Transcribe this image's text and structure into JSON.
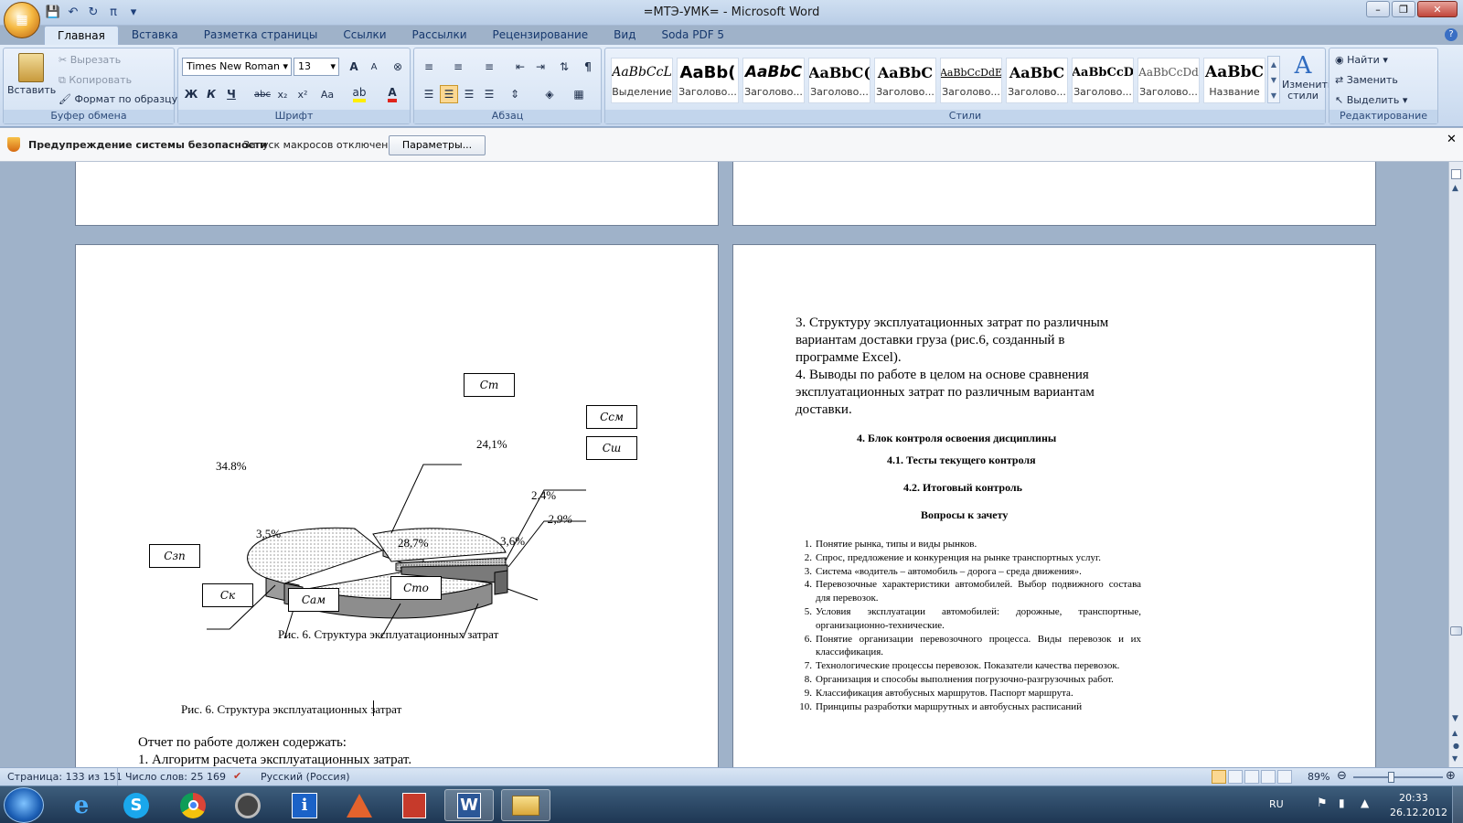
{
  "window": {
    "title": "=МТЭ-УМК= - Microsoft Word"
  },
  "tabs": [
    "Главная",
    "Вставка",
    "Разметка страницы",
    "Ссылки",
    "Рассылки",
    "Рецензирование",
    "Вид",
    "Soda PDF 5"
  ],
  "ribbon": {
    "clipboard": {
      "paste": "Вставить",
      "cut": "Вырезать",
      "copy": "Копировать",
      "format_painter": "Формат по образцу",
      "label": "Буфер обмена"
    },
    "font": {
      "name": "Times New Roman",
      "size": "13",
      "label": "Шрифт",
      "bold": "Ж",
      "italic": "К",
      "underline": "Ч",
      "strike": "abc",
      "sub": "x₂",
      "sup": "x²",
      "case": "Aa",
      "grow": "A",
      "shrink": "A",
      "color_a": "A"
    },
    "paragraph": {
      "label": "Абзац"
    },
    "styles": {
      "label": "Стили",
      "items": [
        {
          "preview": "AaBbCcL",
          "name": "Выделение"
        },
        {
          "preview": "AaBb(",
          "name": "Заголово..."
        },
        {
          "preview": "AaBbC",
          "name": "Заголово..."
        },
        {
          "preview": "AaBbC(",
          "name": "Заголово..."
        },
        {
          "preview": "AaBbC",
          "name": "Заголово..."
        },
        {
          "preview": "AaBbCcDdE",
          "name": "Заголово..."
        },
        {
          "preview": "AaBbC",
          "name": "Заголово..."
        },
        {
          "preview": "AaBbCcD",
          "name": "Заголово..."
        },
        {
          "preview": "AaBbCcDd",
          "name": "Заголово..."
        },
        {
          "preview": "AaBbC",
          "name": "Название"
        }
      ],
      "change": "Изменить стили"
    },
    "editing": {
      "find": "Найти",
      "replace": "Заменить",
      "select": "Выделить",
      "label": "Редактирование"
    }
  },
  "security": {
    "title": "Предупреждение системы безопасности",
    "message": "Запуск макросов отключен.",
    "button": "Параметры..."
  },
  "left_page": {
    "chart": {
      "pct_348": "34.8%",
      "pct_241": "24,1%",
      "pct_24": "2,4%",
      "pct_29": "2,9%",
      "pct_36": "3,6%",
      "pct_287": "28,7%",
      "pct_35": "3,5%",
      "lbl_ct": "Cт",
      "lbl_csm": "Cсм",
      "lbl_csh": "Cш",
      "lbl_cto": "Cто",
      "lbl_cam": "Cам",
      "lbl_ck": "Cк",
      "lbl_czp": "Cзп"
    },
    "fig_caption1": "Рис. 6. Структура эксплуатационных затрат",
    "fig_caption2": "Рис. 6. Структура эксплуатационных затрат",
    "report_heading": "Отчет по работе должен содержать:",
    "report_item1": "1. Алгоритм расчета эксплуатационных затрат."
  },
  "right_page": {
    "p1": "3. Структуру эксплуатационных затрат по различным",
    "p2": "вариантам доставки груза (рис.6, созданный в",
    "p3": "программе Excel).",
    "p4": "4. Выводы по работе в целом на основе сравнения",
    "p5": "эксплуатационных затрат по различным вариантам",
    "p6": "доставки.",
    "h4": "4.   Блок контроля освоения дисциплины",
    "h41": "4.1.  Тесты текущего контроля",
    "h42": "4.2.  Итоговый контроль",
    "questions_title": "Вопросы к зачету",
    "questions": [
      {
        "n": "1.",
        "text": "Понятие рынка, типы и виды рынков."
      },
      {
        "n": "2.",
        "text": "Спрос, предложение и конкуренция на рынке транспортных услуг."
      },
      {
        "n": "3.",
        "text": "Система «водитель – автомобиль – дорога – среда движения»."
      },
      {
        "n": "4.",
        "text": "Перевозочные характеристики автомобилей. Выбор подвижного состава для перевозок."
      },
      {
        "n": "5.",
        "text": "Условия эксплуатации автомобилей: дорожные, транспортные, организационно-технические."
      },
      {
        "n": "6.",
        "text": "Понятие организации перевозочного процесса. Виды перевозок и их классификация."
      },
      {
        "n": "7.",
        "text": "Технологические процессы перевозок. Показатели качества перевозок."
      },
      {
        "n": "8.",
        "text": "Организация и способы выполнения погрузочно-разгрузочных работ."
      },
      {
        "n": "9.",
        "text": "Классификация автобусных маршрутов. Паспорт маршрута."
      },
      {
        "n": "10.",
        "text": "Принципы разработки маршрутных и автобусных расписаний"
      }
    ]
  },
  "status": {
    "page": "Страница: 133 из 151",
    "words": "Число слов: 25 169",
    "language": "Русский (Россия)",
    "zoom": "89%"
  },
  "taskbar": {
    "lang": "RU",
    "time": "20:33",
    "date": "26.12.2012"
  }
}
